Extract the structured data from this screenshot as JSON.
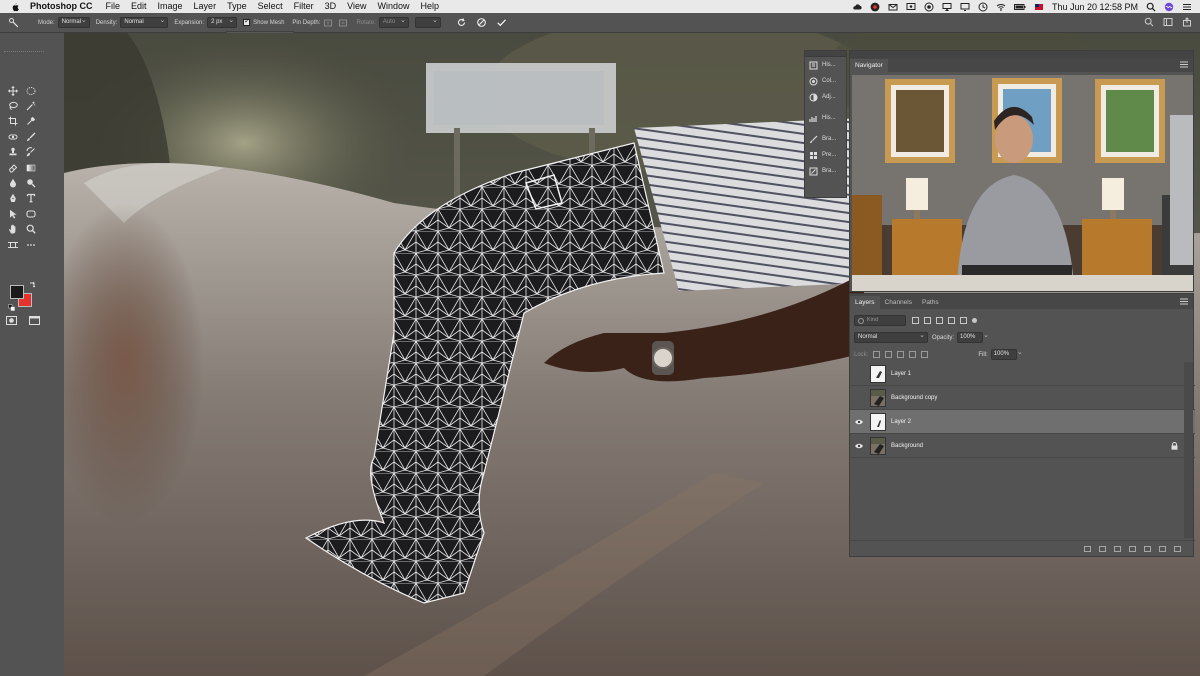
{
  "menubar": {
    "app_name": "Photoshop CC",
    "items": [
      "File",
      "Edit",
      "Image",
      "Layer",
      "Type",
      "Select",
      "Filter",
      "3D",
      "View",
      "Window",
      "Help"
    ],
    "clock": "Thu Jun 20  12:58 PM",
    "status_icons": [
      "cloud-icon",
      "record-icon",
      "mail-icon",
      "screen-icon",
      "camera-icon",
      "airplay-icon",
      "display-icon",
      "clock-icon",
      "wifi-icon",
      "battery-icon",
      "flag-icon"
    ]
  },
  "options_bar": {
    "mode_label": "Mode:",
    "mode_value": "Normal",
    "density_label": "Density:",
    "density_value": "Normal",
    "expansion_label": "Expansion:",
    "expansion_value": "2 px",
    "show_mesh_label": "Show Mesh",
    "show_mesh_checked": true,
    "pin_depth_label": "Pin Depth:",
    "rotate_label": "Rotate:",
    "rotate_value": "Auto"
  },
  "dock": {
    "items": [
      {
        "label": "His...",
        "icon": "history-icon"
      },
      {
        "label": "Col...",
        "icon": "color-icon"
      },
      {
        "label": "Adj...",
        "icon": "adjustments-icon"
      },
      {
        "label": "His...",
        "icon": "histogram-icon"
      },
      {
        "label": "Bra...",
        "icon": "brush-icon"
      },
      {
        "label": "Pre...",
        "icon": "presets-icon"
      },
      {
        "label": "Bra...",
        "icon": "brush-settings-icon"
      }
    ]
  },
  "navigator": {
    "tab_label": "Navigator"
  },
  "layers": {
    "tabs": [
      "Layers",
      "Channels",
      "Paths"
    ],
    "kind_placeholder": "Kind",
    "blend_mode": "Normal",
    "opacity_label": "Opacity:",
    "opacity_value": "100%",
    "lock_label": "Lock:",
    "fill_label": "Fill:",
    "fill_value": "100%",
    "items": [
      {
        "name": "Layer 1",
        "visible": false,
        "selected": false,
        "locked": false
      },
      {
        "name": "Background copy",
        "visible": false,
        "selected": false,
        "locked": false
      },
      {
        "name": "Layer 2",
        "visible": true,
        "selected": true,
        "locked": false
      },
      {
        "name": "Background",
        "visible": true,
        "selected": false,
        "locked": true
      }
    ]
  },
  "colors": {
    "foreground": "#1a1a1a",
    "background": "#e4332c",
    "ui_panel": "#535353",
    "menubar": "#e9e9e9"
  }
}
